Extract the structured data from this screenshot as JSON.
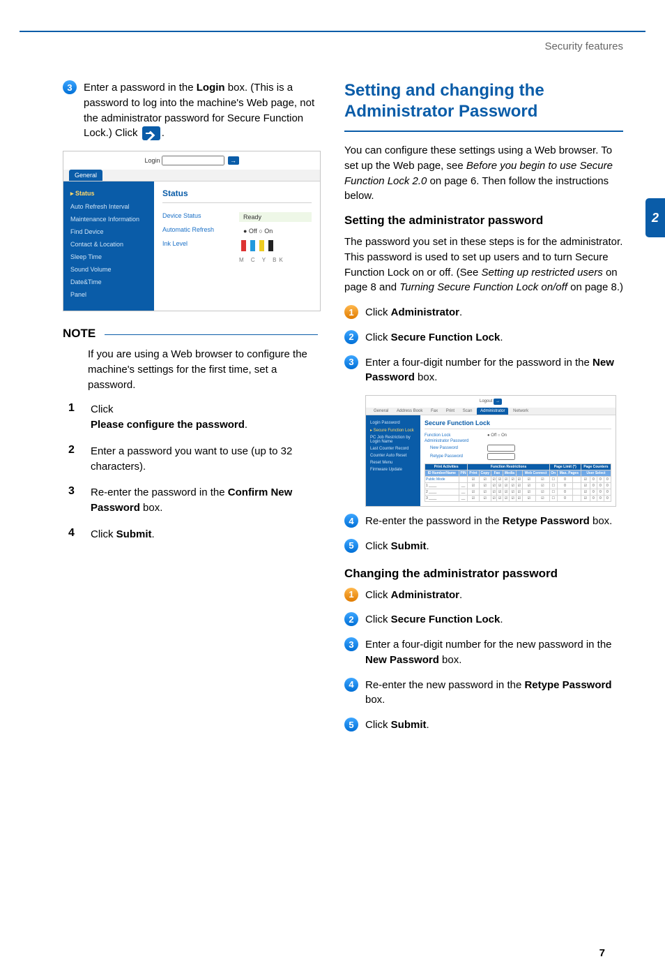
{
  "header": {
    "section": "Security features"
  },
  "left": {
    "step3": {
      "pre": "Enter a password in the ",
      "bold1": "Login",
      "mid1": " box. (This is a password to log into the machine's Web page, not the administrator password for Secure Function Lock.) Click ",
      "post": "."
    },
    "note_title": "NOTE",
    "note_body": "If you are using a Web browser to configure the machine's settings for the first time, set a password.",
    "note_list": {
      "s1_pre": "Click ",
      "s1_bold": "Please configure the password",
      "s1_post": ".",
      "s2": "Enter a password you want to use (up to 32 characters).",
      "s3_pre": "Re-enter the password in the ",
      "s3_bold": "Confirm New Password",
      "s3_post": " box.",
      "s4_pre": "Click ",
      "s4_bold": "Submit",
      "s4_post": "."
    },
    "ss1": {
      "login_label": "Login",
      "tab": "General",
      "side_items": [
        "▸ Status",
        "Auto Refresh Interval",
        "Maintenance Information",
        "Find Device",
        "Contact & Location",
        "Sleep Time",
        "Sound Volume",
        "Date&Time",
        "Panel"
      ],
      "panel_title": "Status",
      "rows": {
        "r1k": "Device Status",
        "r1v": "Ready",
        "r2k": "Automatic Refresh",
        "r2v": "● Off  ○ On",
        "r3k": "Ink Level"
      },
      "ink_legend": "M    C    Y    BK"
    }
  },
  "right": {
    "title1": "Setting and changing the Administrator Password",
    "intro_pre": "You can configure these settings using a Web browser. To set up the Web page, see ",
    "intro_link": "Before you begin to use Secure Function Lock 2.0",
    "intro_post": " on page 6. Then follow the instructions below.",
    "sub1": "Setting the administrator password",
    "sub1_para_pre": "The password you set in these steps is for the administrator. This password is used to set up users and to turn Secure Function Lock on or off. (See ",
    "sub1_para_l1": "Setting up restricted users",
    "sub1_para_mid": " on page 8 and ",
    "sub1_para_l2": "Turning Secure Function Lock on/off",
    "sub1_para_post": " on page 8.)",
    "s1_pre": "Click ",
    "s1_bold": "Administrator",
    "s1_post": ".",
    "s2_pre": "Click ",
    "s2_bold": "Secure Function Lock",
    "s2_post": ".",
    "s3_pre": "Enter a four-digit number for the password in the ",
    "s3_bold": "New Password",
    "s3_post": " box.",
    "s4_pre": "Re-enter the password in the ",
    "s4_bold": "Retype Password",
    "s4_post": " box.",
    "s5_pre": "Click ",
    "s5_bold": "Submit",
    "s5_post": ".",
    "sub2": "Changing the administrator password",
    "c1_pre": "Click ",
    "c1_bold": "Administrator",
    "c1_post": ".",
    "c2_pre": "Click ",
    "c2_bold": "Secure Function Lock",
    "c2_post": ".",
    "c3_pre": "Enter a four-digit number for the new password in the ",
    "c3_bold": "New Password",
    "c3_post": " box.",
    "c4_pre": "Re-enter the new password in the ",
    "c4_bold": "Retype Password",
    "c4_post": " box.",
    "c5_pre": "Click ",
    "c5_bold": "Submit",
    "c5_post": ".",
    "ss2": {
      "tabs": [
        "General",
        "Address Book",
        "Fax",
        "Print",
        "Scan",
        "Administrator",
        "Network"
      ],
      "side": [
        "Login Password",
        "▸ Secure Function Lock",
        "PC Job Restriction by Login Name",
        "Last Counter Record",
        "Counter Auto Reset",
        "Reset Menu",
        "Firmware Update"
      ],
      "title": "Secure Function Lock",
      "f1": "Function Lock",
      "f1v": "● Off  ○ On",
      "f2": "Administrator Password",
      "f3": "New Password",
      "f4": "Retype Password",
      "thead_groups": [
        "Print Activities",
        "",
        "",
        "",
        "Function Restrictions",
        "",
        "",
        "",
        "",
        "",
        "",
        "Page Limit (*)",
        "",
        "",
        "Page Counters",
        "",
        "",
        ""
      ],
      "thead": [
        "ID Number/Name",
        "PIN",
        "Print",
        "Copy",
        "Fax",
        "",
        "Media",
        "",
        "",
        "Web Connect",
        "",
        "On",
        "Max. Pages",
        "",
        "User Select",
        "",
        "",
        ""
      ],
      "row_label": "Public Mode"
    }
  },
  "side_tab": "2",
  "page_num": "7"
}
